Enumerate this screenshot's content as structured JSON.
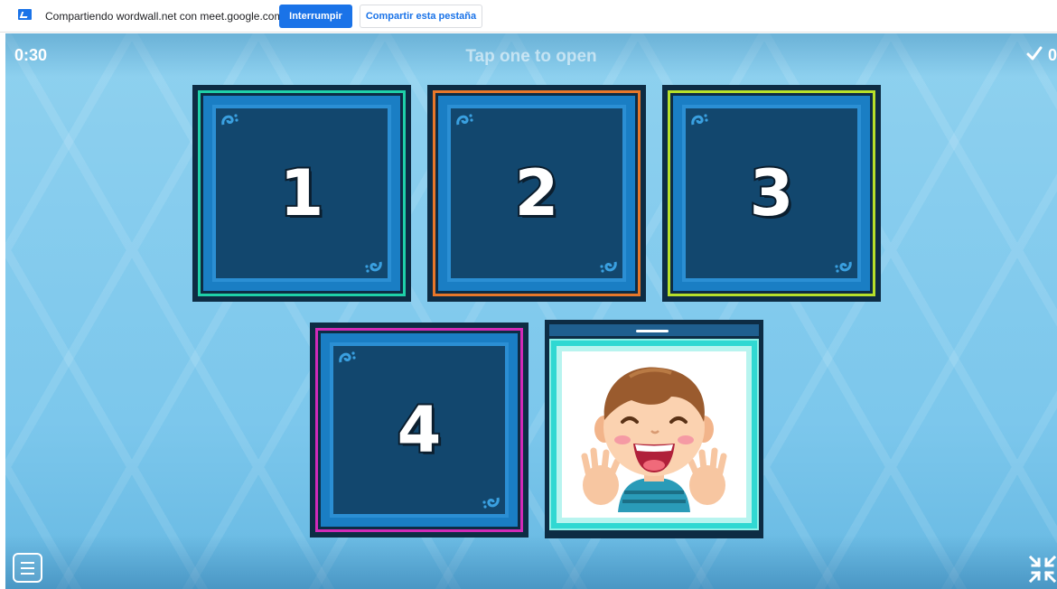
{
  "sharebar": {
    "message": "Compartiendo wordwall.net con meet.google.com",
    "stop_label": "Interrumpir",
    "share_tab_label": "Compartir esta pestaña"
  },
  "game": {
    "timer": "0:30",
    "instruction": "Tap one to open",
    "score": "0",
    "tiles": [
      {
        "number": "1",
        "border_color": "#1fd0a8"
      },
      {
        "number": "2",
        "border_color": "#e7772a"
      },
      {
        "number": "3",
        "border_color": "#b6e02a"
      },
      {
        "number": "4",
        "border_color": "#d12ab8"
      }
    ],
    "opened_card": {
      "image": "laughing-boy-illustration"
    }
  },
  "icons": {
    "share": "screen-share-icon",
    "check": "check-icon",
    "menu": "menu-icon",
    "fullscreen": "exit-fullscreen-icon"
  },
  "colors": {
    "accent": "#1a73e8",
    "stage_bg": "#7cc7ec",
    "tile_dark": "#12476e"
  }
}
